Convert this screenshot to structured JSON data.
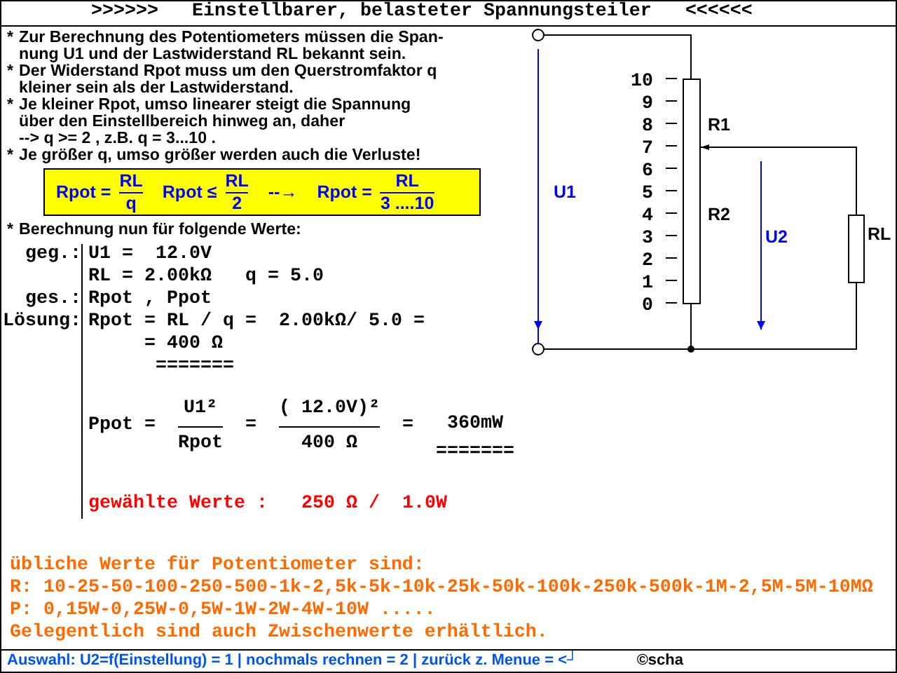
{
  "title": {
    "left": ">>>>>>",
    "text": "Einstellbarer, belasteter Spannungsteiler",
    "right": "<<<<<<"
  },
  "notes": [
    {
      "bullet": "*",
      "lines": [
        "Zur Berechnung des Potentiometers müssen die Span-",
        "nung U1 und der Lastwiderstand RL bekannt sein."
      ]
    },
    {
      "bullet": "*",
      "lines": [
        "Der Widerstand Rpot muss um den Querstromfaktor q",
        "kleiner sein als der Lastwiderstand."
      ]
    },
    {
      "bullet": "*",
      "lines": [
        "Je kleiner Rpot, umso linearer steigt die Spannung",
        "über den Einstellbereich hinweg an, daher",
        "--> q >= 2 , z.B. q = 3...10 ."
      ]
    },
    {
      "bullet": "*",
      "lines": [
        "Je größer q, umso größer werden auch die Verluste!"
      ]
    }
  ],
  "formula_box": [
    {
      "kind": "fraction",
      "left": "Rpot =",
      "num": "RL",
      "den": "q"
    },
    {
      "kind": "fraction",
      "left": "Rpot ≤",
      "num": "RL",
      "den": "2"
    },
    {
      "kind": "text",
      "text": "--→"
    },
    {
      "kind": "fraction",
      "left": "Rpot =",
      "num": "RL",
      "den": "3 ....10"
    }
  ],
  "calc_heading": {
    "bullet": "*",
    "text": "Berechnung nun für folgende Werte:"
  },
  "calc_rows": [
    {
      "label": "geg.:",
      "lines": [
        "U1 =  12.0V",
        "RL = 2.00kΩ   q = 5.0"
      ]
    },
    {
      "label": "ges.:",
      "lines": [
        "Rpot , Ppot"
      ]
    },
    {
      "label": "Lösung:",
      "lines": [
        "Rpot = RL / q =  2.00kΩ/ 5.0 =",
        "     = 400 Ω",
        "      ======="
      ]
    }
  ],
  "power": {
    "left": "Ppot =",
    "frac1": {
      "num": "U1²",
      "den": "Rpot"
    },
    "eq1": "=",
    "frac2": {
      "num": "( 12.0V)²",
      "den": "400 Ω"
    },
    "eq2": "=",
    "result": "360mW",
    "underline": "======="
  },
  "chosen": "gewählte Werte :   250 Ω /  1.0W",
  "info": [
    "übliche Werte für Potentiometer sind:",
    "R: 10-25-50-100-250-500-1k-2,5k-5k-10k-25k-50k-100k-250k-500k-1M-2,5M-5M-10MΩ",
    "P: 0,15W-0,25W-0,5W-1W-2W-4W-10W .....",
    "Gelegentlich sind auch Zwischenwerte erhältlich."
  ],
  "diagram": {
    "scale": [
      "10",
      "9",
      "8",
      "7",
      "6",
      "5",
      "4",
      "3",
      "2",
      "1",
      "0"
    ],
    "r1": "R1",
    "r2": "R2",
    "u1": "U1",
    "u2": "U2",
    "rl": "RL"
  },
  "status": {
    "text": "Auswahl: U2=f(Einstellung) = 1 | nochmals rechnen = 2 | zurück z. Menue = <┘",
    "copyright": "©scha"
  }
}
